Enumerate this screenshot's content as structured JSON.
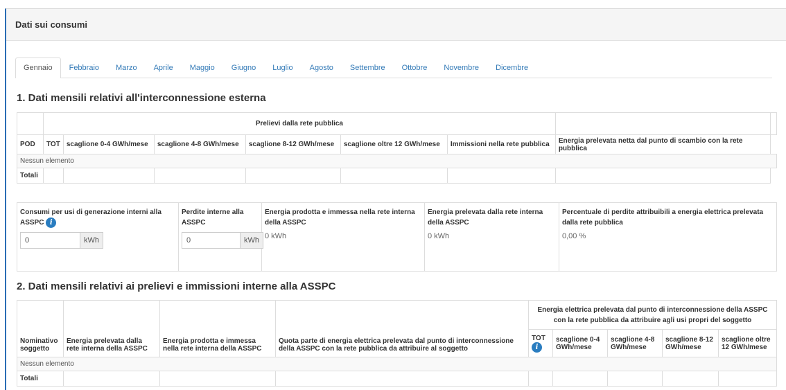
{
  "panel": {
    "title": "Dati sui consumi"
  },
  "tabs": [
    {
      "label": "Gennaio",
      "active": true
    },
    {
      "label": "Febbraio"
    },
    {
      "label": "Marzo"
    },
    {
      "label": "Aprile"
    },
    {
      "label": "Maggio"
    },
    {
      "label": "Giugno"
    },
    {
      "label": "Luglio"
    },
    {
      "label": "Agosto"
    },
    {
      "label": "Settembre"
    },
    {
      "label": "Ottobre"
    },
    {
      "label": "Novembre"
    },
    {
      "label": "Dicembre"
    }
  ],
  "section1": {
    "title": "1. Dati mensili relativi all'interconnessione esterna",
    "group_header": "Prelievi dalla rete pubblica",
    "columns": {
      "pod": "POD",
      "tot": "TOT",
      "s1": "scaglione 0-4 GWh/mese",
      "s2": "scaglione 4-8 GWh/mese",
      "s3": "scaglione 8-12 GWh/mese",
      "s4": "scaglione oltre 12 GWh/mese",
      "immissioni": "Immissioni nella rete pubblica",
      "netta": "Energia prelevata netta dal punto di scambio con la rete pubblica"
    },
    "empty": "Nessun elemento",
    "totals": "Totali"
  },
  "summary": {
    "consumi_label": "Consumi per usi di generazione interni alla ASSPC",
    "consumi_value": "0",
    "consumi_unit": "kWh",
    "perdite_label": "Perdite interne alla ASSPC",
    "perdite_value": "0",
    "perdite_unit": "kWh",
    "prodotta_label": "Energia prodotta e immessa nella rete interna della ASSPC",
    "prodotta_value": "0 kWh",
    "prelevata_label": "Energia prelevata dalla rete interna della ASSPC",
    "prelevata_value": "0 kWh",
    "percentuale_label": "Percentuale di perdite attribuibili a energia elettrica prelevata dalla rete pubblica",
    "percentuale_value": "0,00 %"
  },
  "section2": {
    "title": "2. Dati mensili relativi ai prelievi e immissioni interne alla ASSPC",
    "group_header": "Energia elettrica prelevata dal punto di interconnessione della ASSPC con la rete pubblica da attribuire agli usi propri del soggetto",
    "columns": {
      "nominativo": "Nominativo soggetto",
      "prelevata": "Energia prelevata dalla rete interna della ASSPC",
      "prodotta": "Energia prodotta e immessa nella rete interna della ASSPC",
      "quota": "Quota parte di energia elettrica prelevata dal punto di interconnessione della ASSPC con la rete pubblica da attribuire al soggetto",
      "tot": "TOT",
      "s1": "scaglione 0-4 GWh/mese",
      "s2": "scaglione 4-8 GWh/mese",
      "s3": "scaglione 8-12 GWh/mese",
      "s4": "scaglione oltre 12 GWh/mese"
    },
    "empty": "Nessun elemento",
    "totals": "Totali"
  },
  "icons": {
    "info": "info-icon"
  },
  "colors": {
    "accent": "#2a6db5",
    "link": "#337ab7",
    "info": "#2a7dc0"
  }
}
